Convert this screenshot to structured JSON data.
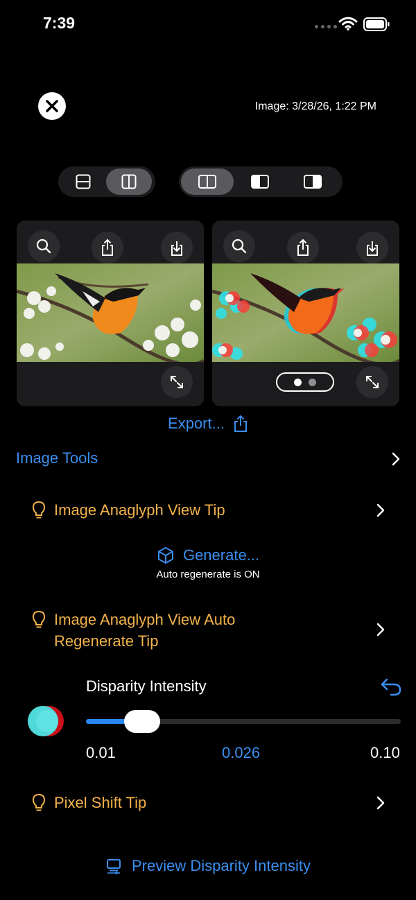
{
  "status": {
    "time": "7:39"
  },
  "header": {
    "image_meta": "Image: 3/28/26, 1:22 PM"
  },
  "layout_segment": {
    "options": [
      "horizontal-split-icon",
      "vertical-split-icon"
    ],
    "selected": 1
  },
  "view_segment": {
    "options": [
      "side-by-side-icon",
      "left-half-icon",
      "right-half-icon"
    ],
    "selected": 0
  },
  "cards": [
    {
      "name": "original",
      "buttons": [
        "magnify-icon",
        "share-icon",
        "download-icon"
      ]
    },
    {
      "name": "anaglyph",
      "buttons": [
        "magnify-icon",
        "share-icon",
        "download-icon"
      ],
      "pager": {
        "pages": 2,
        "current": 0
      }
    }
  ],
  "export": {
    "label": "Export..."
  },
  "image_tools": {
    "label": "Image Tools"
  },
  "tips": {
    "anaglyph_view": "Image Anaglyph View Tip",
    "auto_regenerate_line1": "Image Anaglyph View Auto",
    "auto_regenerate_line2": "Regenerate Tip",
    "pixel_shift": "Pixel Shift Tip"
  },
  "generate": {
    "label": "Generate...",
    "subtitle": "Auto regenerate is ON"
  },
  "disparity": {
    "label": "Disparity Intensity",
    "min": 0.01,
    "max": 0.1,
    "value": 0.026,
    "min_label": "0.01",
    "value_label": "0.026",
    "max_label": "0.10"
  },
  "preview": {
    "label": "Preview Disparity Intensity"
  },
  "colors": {
    "accent": "#3b8ff0",
    "tip": "#f2b24a",
    "card": "#1c1c1e"
  }
}
